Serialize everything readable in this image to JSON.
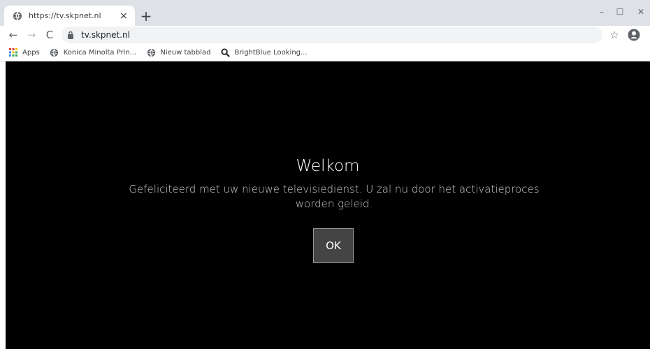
{
  "browser": {
    "tab": {
      "title": "https://tv.skpnet.nl",
      "close_glyph": "×",
      "favicon": "globe-icon"
    },
    "new_tab_glyph": "+",
    "window_controls": {
      "minimize": "–",
      "maximize": "☐",
      "close": "✕"
    },
    "nav": {
      "back": "←",
      "forward": "→",
      "reload": "C"
    },
    "address": {
      "url": "tv.skpnet.nl",
      "icon": "lock-icon"
    },
    "star_glyph": "☆",
    "bookmarks": [
      {
        "label": "Apps",
        "icon": "apps-grid-icon"
      },
      {
        "label": "Konica Minolta Prin...",
        "icon": "globe-icon"
      },
      {
        "label": "Nieuw tabblad",
        "icon": "globe-icon"
      },
      {
        "label": "BrightBlue Looking...",
        "icon": "search-icon"
      }
    ]
  },
  "dialog": {
    "title": "Welkom",
    "message": "Gefeliciteerd met uw nieuwe televisiedienst. U zal nu door het activatieproces worden geleid.",
    "ok_label": "OK"
  },
  "colors": {
    "page_background": "#000000",
    "tabstrip": "#dee1e6",
    "apps_colors": [
      "#ea4335",
      "#fbbc05",
      "#34a853",
      "#4285f4"
    ]
  }
}
